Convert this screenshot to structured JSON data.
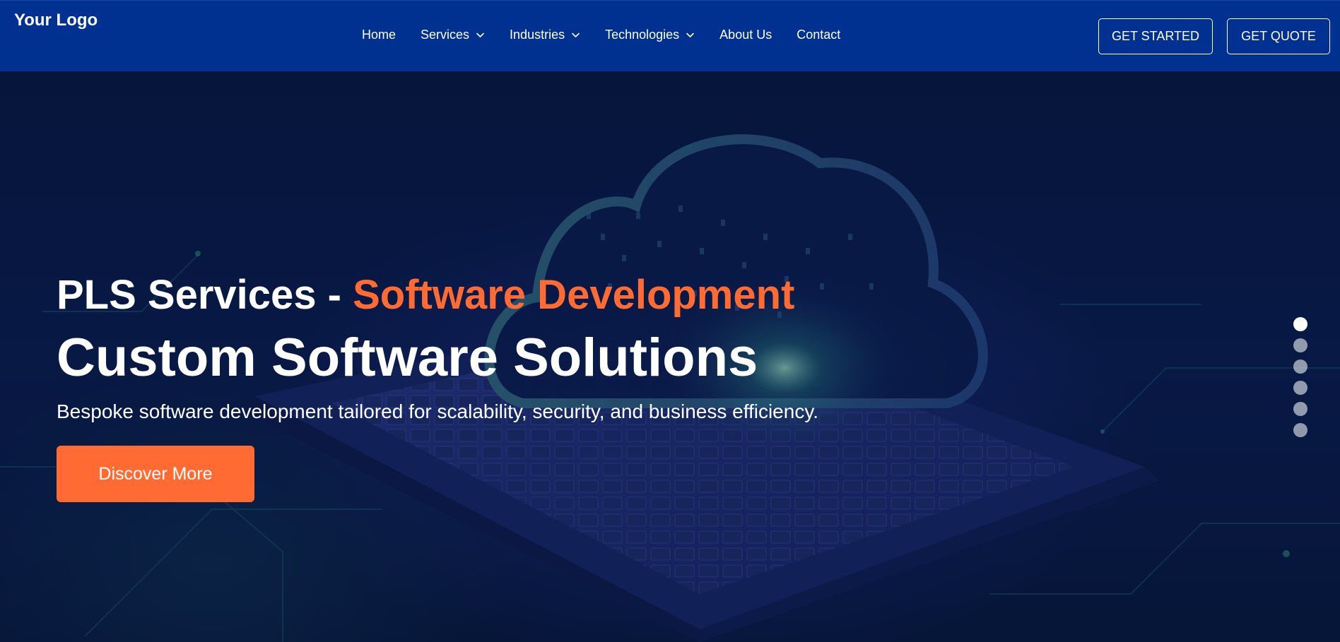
{
  "header": {
    "logo": "Your Logo",
    "nav": [
      {
        "label": "Home",
        "has_dropdown": false
      },
      {
        "label": "Services",
        "has_dropdown": true
      },
      {
        "label": "Industries",
        "has_dropdown": true
      },
      {
        "label": "Technologies",
        "has_dropdown": true
      },
      {
        "label": "About Us",
        "has_dropdown": false
      },
      {
        "label": "Contact",
        "has_dropdown": false
      }
    ],
    "get_started_label": "GET STARTED",
    "get_quote_label": "GET QUOTE"
  },
  "hero": {
    "kicker_prefix": "PLS Services - ",
    "kicker_accent": "Software Development",
    "title": "Custom Software Solutions",
    "subtitle": "Bespoke software development tailored for scalability, security, and business efficiency.",
    "cta_label": "Discover More",
    "slider": {
      "total_slides": 6,
      "active_index": 0
    }
  },
  "colors": {
    "header_bg": "#003090",
    "hero_bg": "#06163d",
    "accent": "#ff6b33",
    "text": "#ffffff"
  }
}
